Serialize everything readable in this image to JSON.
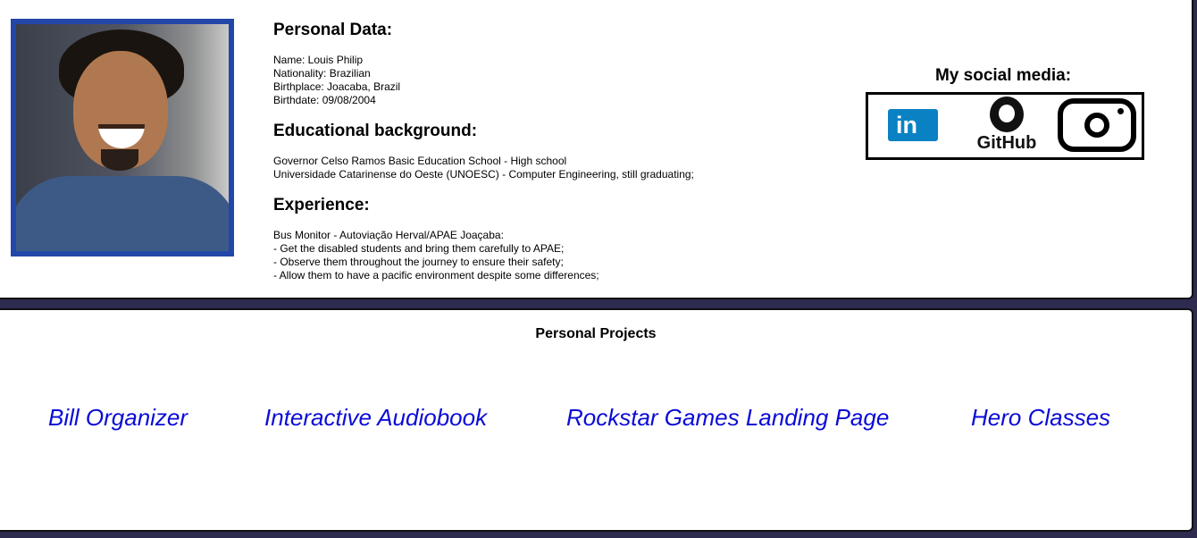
{
  "personal": {
    "heading": "Personal Data:",
    "lines": [
      "Name: Louis Philip",
      "Nationality: Brazilian",
      "Birthplace: Joacaba, Brazil",
      "Birthdate: 09/08/2004"
    ]
  },
  "education": {
    "heading": "Educational background:",
    "lines": [
      "Governor Celso Ramos Basic Education School - High school",
      "Universidade Catarinense do Oeste (UNOESC) - Computer Engineering, still graduating;"
    ]
  },
  "experience": {
    "heading": "Experience:",
    "lines": [
      "Bus Monitor - Autoviação Herval/APAE Joaçaba:",
      "- Get the disabled students and bring them carefully to APAE;",
      "- Observe them throughout the journey to ensure their safety;",
      "- Allow them to have a pacific environment despite some differences;"
    ]
  },
  "social": {
    "heading": "My social media:",
    "linkedin_text": "in",
    "github_text": "GitHub",
    "icons": [
      "linkedin-icon",
      "github-icon",
      "instagram-icon"
    ]
  },
  "projects": {
    "heading": "Personal Projects",
    "items": [
      "Bill Organizer",
      "Interactive Audiobook",
      "Rockstar Games Landing Page",
      "Hero Classes"
    ]
  },
  "colors": {
    "background": "#2d2b4f",
    "photo_frame": "#2247a8",
    "link": "#0b0bd6",
    "linkedin": "#0a81c3"
  }
}
